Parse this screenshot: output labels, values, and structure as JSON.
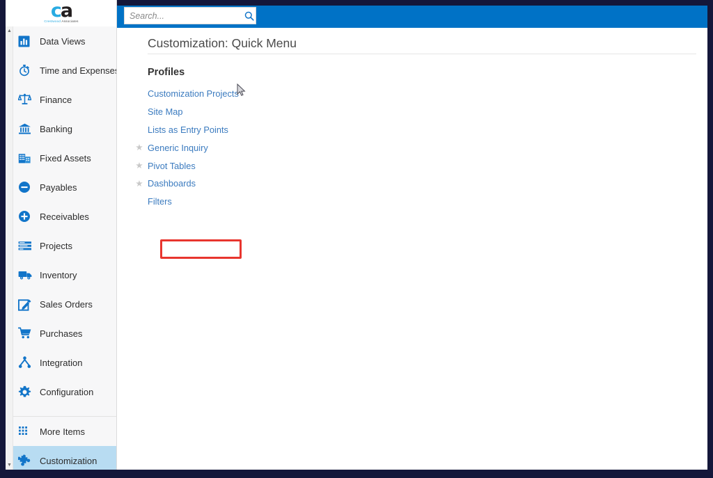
{
  "window": {
    "frame_color": "#14173a",
    "header_color": "#0072c6",
    "accent_link_color": "#3b7bbf",
    "highlight_color": "#e8352e",
    "selected_row_color": "#b8dcf2"
  },
  "logo": {
    "mark_first": "c",
    "mark_second": "a",
    "subtitle_word1": "Crestwood",
    "subtitle_word2": "Associates"
  },
  "search": {
    "placeholder": "Search...",
    "value": "",
    "icon": "search-icon"
  },
  "sidebar": {
    "scroll_up_glyph": "▲",
    "scroll_down_glyph": "▼",
    "items": [
      {
        "label": "Data Views",
        "icon": "bar-chart-icon",
        "selected": false
      },
      {
        "label": "Time and Expenses",
        "icon": "stopwatch-icon",
        "selected": false
      },
      {
        "label": "Finance",
        "icon": "scales-icon",
        "selected": false
      },
      {
        "label": "Banking",
        "icon": "bank-icon",
        "selected": false
      },
      {
        "label": "Fixed Assets",
        "icon": "building-icon",
        "selected": false
      },
      {
        "label": "Payables",
        "icon": "minus-circle-icon",
        "selected": false
      },
      {
        "label": "Receivables",
        "icon": "plus-circle-icon",
        "selected": false
      },
      {
        "label": "Projects",
        "icon": "list-bars-icon",
        "selected": false
      },
      {
        "label": "Inventory",
        "icon": "truck-icon",
        "selected": false
      },
      {
        "label": "Sales Orders",
        "icon": "edit-square-icon",
        "selected": false
      },
      {
        "label": "Purchases",
        "icon": "cart-icon",
        "selected": false
      },
      {
        "label": "Integration",
        "icon": "node-tree-icon",
        "selected": false
      },
      {
        "label": "Configuration",
        "icon": "gear-icon",
        "selected": false
      },
      {
        "label": "More Items",
        "icon": "grid-dots-icon",
        "selected": false
      },
      {
        "label": "Customization",
        "icon": "puzzle-piece-icon",
        "selected": true
      }
    ]
  },
  "main": {
    "page_title": "Customization: Quick Menu",
    "section_title": "Profiles",
    "links": [
      {
        "label": "Customization Projects",
        "starred": false
      },
      {
        "label": "Site Map",
        "starred": false
      },
      {
        "label": "Lists as Entry Points",
        "starred": false
      },
      {
        "label": "Generic Inquiry",
        "starred": true
      },
      {
        "label": "Pivot Tables",
        "starred": true
      },
      {
        "label": "Dashboards",
        "starred": true
      },
      {
        "label": "Filters",
        "starred": false
      }
    ],
    "star_glyph": "★",
    "highlighted_link": "Filters"
  }
}
